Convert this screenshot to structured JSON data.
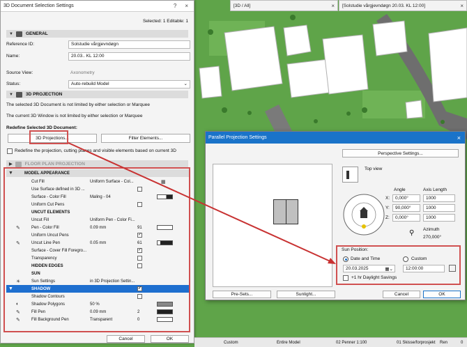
{
  "tabs": {
    "t1": "[3D / All]",
    "t2": "[Solstudie vårgjevndøgn 20.03. KL 12:00]"
  },
  "panel": {
    "title": "3D Document Selection Settings",
    "selected_info": "Selected: 1 Editable: 1",
    "general": {
      "header": "GENERAL",
      "ref_label": "Reference ID:",
      "ref_value": "Solstudie vårgjevndøgn",
      "name_label": "Name:",
      "name_value": "20.03.. KL 12:00",
      "source_label": "Source View:",
      "source_value": "Axonometry",
      "status_label": "Status:",
      "status_value": "Auto-rebuild Model"
    },
    "projection": {
      "header": "3D PROJECTION",
      "line1": "The selected 3D Document is not limited by either selection or Marquee",
      "line2": "The current 3D Window is not limited by either selection or Marquee",
      "redefine_label": "Redefine Selected 3D Document:",
      "btn_projections": "3D Projections...",
      "btn_filter": "Filter Elements...",
      "redefine_check": "Redefine the projection, cutting planes and visible elements based on current 3D"
    },
    "floor_plan": "FLOOR PLAN PROJECTION",
    "model_appearance": "MODEL APPEARANCE",
    "rows": {
      "cut_fill": {
        "name": "Cut Fill",
        "value": "Uniform Surface - Col..."
      },
      "use_surface": {
        "name": "Use Surface defined in 3D ..."
      },
      "surface_color": {
        "name": "Surface - Color Fill",
        "value": "Maling - 04"
      },
      "uniform_cut_pens": {
        "name": "Uniform Cut Pens"
      },
      "uncut_hdr": "UNCUT ELEMENTS",
      "uncut_fill": {
        "name": "Uncut Fill",
        "value": "Uniform Pen - Color Fi..."
      },
      "pen_color": {
        "name": "Pen - Color Fill",
        "value": "0.09 mm",
        "num": "91"
      },
      "uniform_uncut": {
        "name": "Uniform Uncut Pens"
      },
      "uncut_line": {
        "name": "Uncut Line Pen",
        "value": "0.05 mm",
        "num": "61"
      },
      "surface_cover": {
        "name": "Surface - Cover Fill Foregro..."
      },
      "transparency": {
        "name": "Transparency"
      },
      "hidden_edges": "HIDDEN EDGES",
      "sun_hdr": "SUN",
      "sun_settings": {
        "name": "Sun Settings",
        "value": "in 3D Projection Settin..."
      },
      "shadow": "SHADOW",
      "shadow_contours": {
        "name": "Shadow Contours"
      },
      "shadow_polygons": {
        "name": "Shadow Polygons",
        "value": "50 %"
      },
      "fill_pen": {
        "name": "Fill Pen",
        "value": "0.09 mm",
        "num": "2"
      },
      "fill_bg": {
        "name": "Fill Background Pen",
        "value": "Transparent",
        "num": "0"
      }
    },
    "cancel": "Cancel",
    "ok": "OK"
  },
  "dialog": {
    "title": "Parallel Projection Settings",
    "perspective_btn": "Perspective Settings...",
    "view_name": "Top view",
    "angle_hdr": "Angle",
    "axis_hdr": "Axis Length",
    "x_label": "X:",
    "x_angle": "0,000°",
    "x_len": "1000",
    "y_label": "Y:",
    "y_angle": "90,000°",
    "y_len": "1000",
    "z_label": "Z:",
    "z_angle": "0,000°",
    "z_len": "1000",
    "azimuth_label": "Azimuth",
    "azimuth_value": "270,000°",
    "sun_pos": "Sun Position:",
    "date_time": "Date and Time",
    "custom": "Custom",
    "date": "20.03.2025",
    "time": "12:00:00",
    "dst": "+1 hr Daylight Savings",
    "presets": "Pre-Sets...",
    "sunlight": "Sunlight...",
    "cancel": "Cancel",
    "ok": "OK"
  },
  "status": {
    "custom": "Custom",
    "entire": "Entire Model",
    "penner": "02 Penner 1:100",
    "skisse": "01 Skisse/forprosjekt",
    "ren": "Ren",
    "zero": "0"
  }
}
